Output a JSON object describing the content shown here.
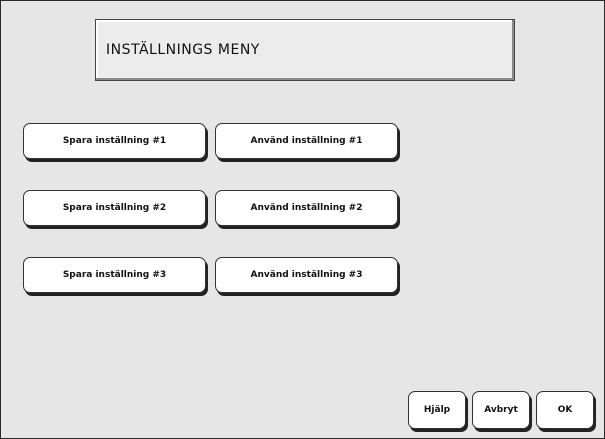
{
  "title": "INSTÄLLNINGS MENY",
  "settings": [
    {
      "save_label": "Spara inställning #1",
      "use_label": "Använd inställning #1"
    },
    {
      "save_label": "Spara inställning #2",
      "use_label": "Använd inställning #2"
    },
    {
      "save_label": "Spara inställning #3",
      "use_label": "Använd inställning #3"
    }
  ],
  "footer": {
    "help_label": "Hjälp",
    "cancel_label": "Avbryt",
    "ok_label": "OK"
  }
}
